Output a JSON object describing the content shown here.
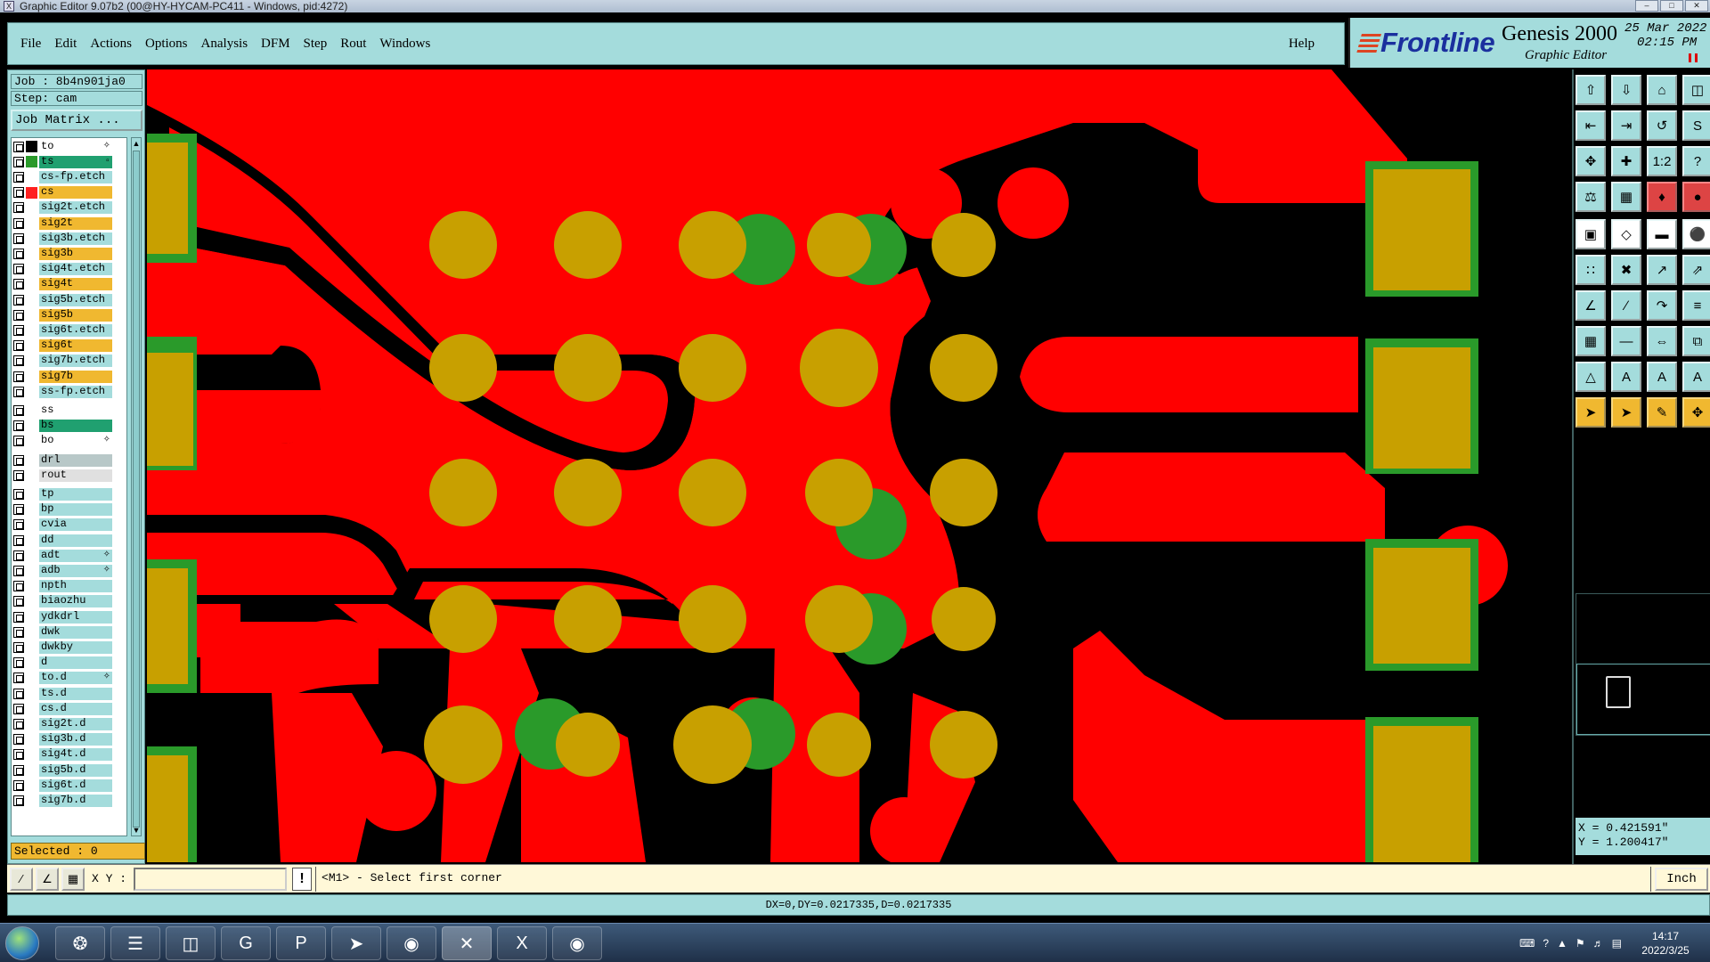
{
  "window": {
    "title": "Graphic Editor 9.07b2 (00@HY-HYCAM-PC411 - Windows, pid:4272)"
  },
  "menu": {
    "items": [
      "File",
      "Edit",
      "Actions",
      "Options",
      "Analysis",
      "DFM",
      "Step",
      "Rout",
      "Windows"
    ],
    "help": "Help"
  },
  "brand": {
    "logo": "Frontline",
    "product": "Genesis 2000",
    "subtitle": "Graphic Editor",
    "date": "25 Mar 2022",
    "time": "02:15 PM"
  },
  "job": {
    "job_label": "Job : 8b4n901ja0",
    "step_label": "Step: cam",
    "matrix_button": "Job Matrix ..."
  },
  "layers": [
    {
      "name": "to",
      "bg": "#ffffff",
      "swatch": "#000000",
      "mark": "✧"
    },
    {
      "name": "ts",
      "bg": "#20a070",
      "swatch": "#2a9a2a",
      "mark": "▫"
    },
    {
      "name": "cs-fp.etch",
      "bg": "#a4dcdc",
      "swatch": "",
      "mark": ""
    },
    {
      "name": "cs",
      "bg": "#f0b830",
      "swatch": "#ff2020",
      "mark": ""
    },
    {
      "name": "sig2t.etch",
      "bg": "#a4dcdc",
      "swatch": "",
      "mark": ""
    },
    {
      "name": "sig2t",
      "bg": "#f0b830",
      "swatch": "",
      "mark": ""
    },
    {
      "name": "sig3b.etch",
      "bg": "#a4dcdc",
      "swatch": "",
      "mark": ""
    },
    {
      "name": "sig3b",
      "bg": "#f0b830",
      "swatch": "",
      "mark": ""
    },
    {
      "name": "sig4t.etch",
      "bg": "#a4dcdc",
      "swatch": "",
      "mark": ""
    },
    {
      "name": "sig4t",
      "bg": "#f0b830",
      "swatch": "",
      "mark": ""
    },
    {
      "name": "sig5b.etch",
      "bg": "#a4dcdc",
      "swatch": "",
      "mark": ""
    },
    {
      "name": "sig5b",
      "bg": "#f0b830",
      "swatch": "",
      "mark": ""
    },
    {
      "name": "sig6t.etch",
      "bg": "#a4dcdc",
      "swatch": "",
      "mark": ""
    },
    {
      "name": "sig6t",
      "bg": "#f0b830",
      "swatch": "",
      "mark": ""
    },
    {
      "name": "sig7b.etch",
      "bg": "#a4dcdc",
      "swatch": "",
      "mark": ""
    },
    {
      "name": "sig7b",
      "bg": "#f0b830",
      "swatch": "",
      "mark": ""
    },
    {
      "name": "ss-fp.etch",
      "bg": "#a4dcdc",
      "swatch": "",
      "mark": ""
    },
    {
      "name": "ss",
      "bg": "#ffffff",
      "swatch": "",
      "mark": ""
    },
    {
      "name": "bs",
      "bg": "#20a070",
      "swatch": "",
      "mark": ""
    },
    {
      "name": "bo",
      "bg": "#ffffff",
      "swatch": "",
      "mark": "✧"
    },
    {
      "name": "drl",
      "bg": "#b8c8c8",
      "swatch": "",
      "mark": ""
    },
    {
      "name": "rout",
      "bg": "#e0e0e0",
      "swatch": "",
      "mark": ""
    },
    {
      "name": "tp",
      "bg": "#a4dcdc",
      "swatch": "",
      "mark": ""
    },
    {
      "name": "bp",
      "bg": "#a4dcdc",
      "swatch": "",
      "mark": ""
    },
    {
      "name": "cvia",
      "bg": "#a4dcdc",
      "swatch": "",
      "mark": ""
    },
    {
      "name": "dd",
      "bg": "#a4dcdc",
      "swatch": "",
      "mark": ""
    },
    {
      "name": "adt",
      "bg": "#a4dcdc",
      "swatch": "",
      "mark": "✧"
    },
    {
      "name": "adb",
      "bg": "#a4dcdc",
      "swatch": "",
      "mark": "✧"
    },
    {
      "name": "npth",
      "bg": "#a4dcdc",
      "swatch": "",
      "mark": ""
    },
    {
      "name": "biaozhu",
      "bg": "#a4dcdc",
      "swatch": "",
      "mark": ""
    },
    {
      "name": "ydkdrl",
      "bg": "#a4dcdc",
      "swatch": "",
      "mark": ""
    },
    {
      "name": "dwk",
      "bg": "#a4dcdc",
      "swatch": "",
      "mark": ""
    },
    {
      "name": "dwkby",
      "bg": "#a4dcdc",
      "swatch": "",
      "mark": ""
    },
    {
      "name": "d",
      "bg": "#a4dcdc",
      "swatch": "",
      "mark": ""
    },
    {
      "name": "to.d",
      "bg": "#a4dcdc",
      "swatch": "",
      "mark": "✧"
    },
    {
      "name": "ts.d",
      "bg": "#a4dcdc",
      "swatch": "",
      "mark": ""
    },
    {
      "name": "cs.d",
      "bg": "#a4dcdc",
      "swatch": "",
      "mark": ""
    },
    {
      "name": "sig2t.d",
      "bg": "#a4dcdc",
      "swatch": "",
      "mark": ""
    },
    {
      "name": "sig3b.d",
      "bg": "#a4dcdc",
      "swatch": "",
      "mark": ""
    },
    {
      "name": "sig4t.d",
      "bg": "#a4dcdc",
      "swatch": "",
      "mark": ""
    },
    {
      "name": "sig5b.d",
      "bg": "#a4dcdc",
      "swatch": "",
      "mark": ""
    },
    {
      "name": "sig6t.d",
      "bg": "#a4dcdc",
      "swatch": "",
      "mark": ""
    },
    {
      "name": "sig7b.d",
      "bg": "#a4dcdc",
      "swatch": "",
      "mark": ""
    }
  ],
  "selected_label": "Selected : 0",
  "coords": {
    "x": "X = 0.421591\"",
    "y": "Y = 1.200417\""
  },
  "toolbar_labels": {
    "ratio": "1:2",
    "help": "?"
  },
  "command": {
    "xy_label": "X Y :",
    "xy_value": "",
    "warn": "!",
    "prompt": "<M1> - Select first corner",
    "units": "Inch"
  },
  "status": "DX=0,DY=0.0217335,D=0.0217335",
  "taskbar": {
    "time": "14:17",
    "date": "2022/3/25"
  },
  "colors": {
    "copper": "#ff0000",
    "pad": "#c8a000",
    "mask": "#2a9a2a",
    "panel": "#a4dcdc",
    "active_layer": "#f0b830"
  }
}
